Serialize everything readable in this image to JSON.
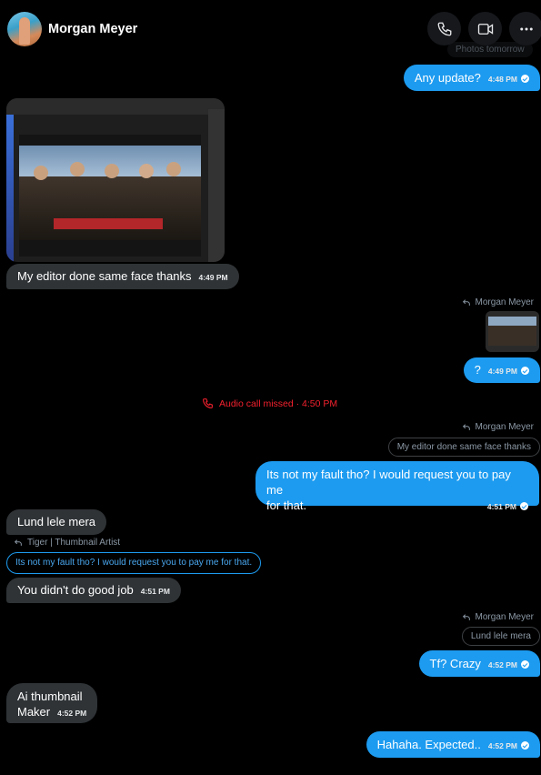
{
  "header": {
    "contact_name": "Morgan Meyer",
    "top_partial_text": "Photos tomorrow",
    "icons": [
      "phone-icon",
      "video-icon",
      "more-icon"
    ]
  },
  "messages": {
    "m1": {
      "text": "Any update?",
      "time": "4:48 PM"
    },
    "m2": {
      "text": "My editor done same face thanks",
      "time": "4:49 PM"
    },
    "m3": {
      "reply_to": "Morgan Meyer",
      "text": "?",
      "time": "4:49 PM"
    },
    "call": {
      "text": "Audio call missed · 4:50 PM"
    },
    "m4": {
      "reply_to": "Morgan Meyer",
      "quote": "My editor done same face thanks",
      "line1": "Its not my fault tho? I would request you to pay me",
      "line2": "for that.",
      "time": "4:51 PM"
    },
    "m5": {
      "text": "Lund lele mera"
    },
    "m6": {
      "reply_to": "Tiger | Thumbnail Artist",
      "quote": "Its not my fault tho? I would request you to pay me for that.",
      "text": "You didn't do good job",
      "time": "4:51 PM"
    },
    "m7": {
      "reply_to": "Morgan Meyer",
      "quote": "Lund lele mera",
      "text": "Tf? Crazy",
      "time": "4:52 PM"
    },
    "m8": {
      "line1": "Ai thumbnail",
      "line2": "Maker",
      "time": "4:52 PM"
    },
    "m9": {
      "text": "Hahaha. Expected..",
      "time": "4:52 PM"
    }
  },
  "colors": {
    "accent": "#1d9bf0",
    "incoming": "#2f3336",
    "missed": "#f4212e"
  }
}
